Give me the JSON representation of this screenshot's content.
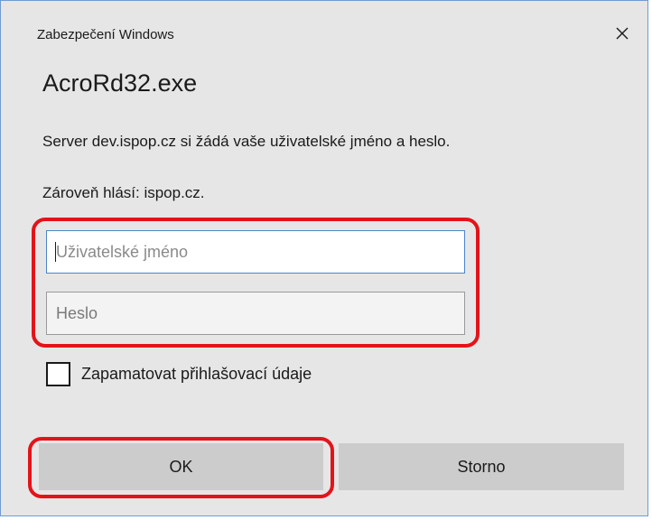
{
  "dialog": {
    "title": "Zabezpečení Windows",
    "app_name": "AcroRd32.exe",
    "message": "Server dev.ispop.cz si žádá vaše uživatelské jméno a heslo.",
    "realm": "Zároveň hlásí: ispop.cz."
  },
  "form": {
    "username": {
      "value": "",
      "placeholder": "Uživatelské jméno"
    },
    "password": {
      "value": "",
      "placeholder": "Heslo"
    },
    "remember": {
      "label": "Zapamatovat přihlašovací údaje",
      "checked": false
    }
  },
  "buttons": {
    "ok_label": "OK",
    "cancel_label": "Storno"
  },
  "icons": {
    "close": "close-icon"
  },
  "colors": {
    "highlight": "#e2141a",
    "focus_border": "#4a86c8",
    "dialog_background": "#e6e6e6"
  }
}
